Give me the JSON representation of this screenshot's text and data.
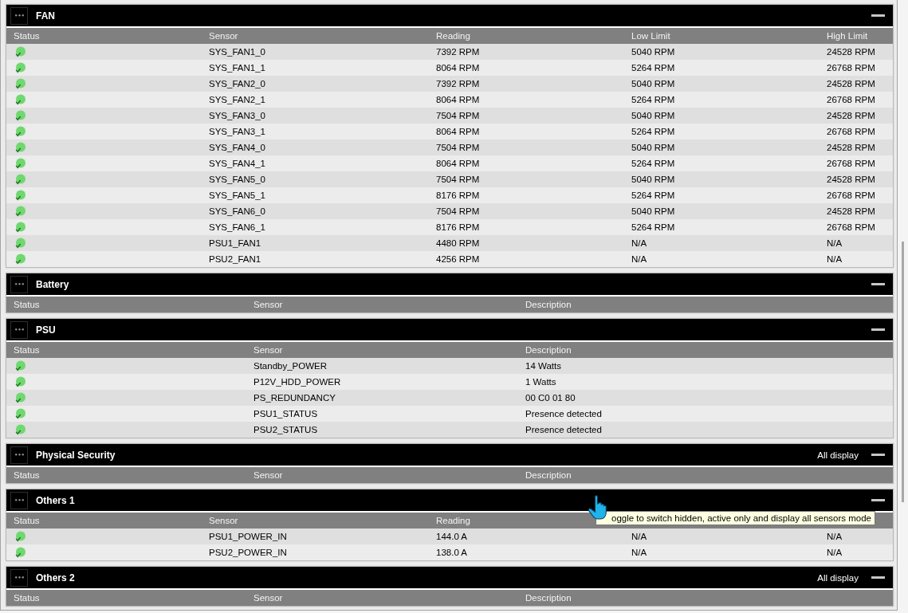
{
  "sections": [
    {
      "title": "FAN",
      "columns": [
        "Status",
        "Sensor",
        "Reading",
        "Low Limit",
        "High Limit"
      ],
      "rows": [
        {
          "ok": true,
          "cells": [
            "",
            "SYS_FAN1_0",
            "7392 RPM",
            "5040 RPM",
            "24528 RPM"
          ]
        },
        {
          "ok": true,
          "cells": [
            "",
            "SYS_FAN1_1",
            "8064 RPM",
            "5264 RPM",
            "26768 RPM"
          ]
        },
        {
          "ok": true,
          "cells": [
            "",
            "SYS_FAN2_0",
            "7392 RPM",
            "5040 RPM",
            "24528 RPM"
          ]
        },
        {
          "ok": true,
          "cells": [
            "",
            "SYS_FAN2_1",
            "8064 RPM",
            "5264 RPM",
            "26768 RPM"
          ]
        },
        {
          "ok": true,
          "cells": [
            "",
            "SYS_FAN3_0",
            "7504 RPM",
            "5040 RPM",
            "24528 RPM"
          ]
        },
        {
          "ok": true,
          "cells": [
            "",
            "SYS_FAN3_1",
            "8064 RPM",
            "5264 RPM",
            "26768 RPM"
          ]
        },
        {
          "ok": true,
          "cells": [
            "",
            "SYS_FAN4_0",
            "7504 RPM",
            "5040 RPM",
            "24528 RPM"
          ]
        },
        {
          "ok": true,
          "cells": [
            "",
            "SYS_FAN4_1",
            "8064 RPM",
            "5264 RPM",
            "26768 RPM"
          ]
        },
        {
          "ok": true,
          "cells": [
            "",
            "SYS_FAN5_0",
            "7504 RPM",
            "5040 RPM",
            "24528 RPM"
          ]
        },
        {
          "ok": true,
          "cells": [
            "",
            "SYS_FAN5_1",
            "8176 RPM",
            "5264 RPM",
            "26768 RPM"
          ]
        },
        {
          "ok": true,
          "cells": [
            "",
            "SYS_FAN6_0",
            "7504 RPM",
            "5040 RPM",
            "24528 RPM"
          ]
        },
        {
          "ok": true,
          "cells": [
            "",
            "SYS_FAN6_1",
            "8176 RPM",
            "5264 RPM",
            "26768 RPM"
          ]
        },
        {
          "ok": true,
          "cells": [
            "",
            "PSU1_FAN1",
            "4480 RPM",
            "N/A",
            "N/A"
          ]
        },
        {
          "ok": true,
          "cells": [
            "",
            "PSU2_FAN1",
            "4256 RPM",
            "N/A",
            "N/A"
          ]
        }
      ]
    },
    {
      "title": "Battery",
      "columns": [
        "Status",
        "Sensor",
        "Description"
      ]
    },
    {
      "title": "PSU",
      "columns": [
        "Status",
        "Sensor",
        "Description"
      ],
      "rows": [
        {
          "ok": true,
          "cells": [
            "",
            "Standby_POWER",
            "14 Watts"
          ]
        },
        {
          "ok": true,
          "cells": [
            "",
            "P12V_HDD_POWER",
            "1 Watts"
          ]
        },
        {
          "ok": true,
          "cells": [
            "",
            "PS_REDUNDANCY",
            "00 C0 01 80"
          ]
        },
        {
          "ok": true,
          "cells": [
            "",
            "PSU1_STATUS",
            "Presence detected"
          ]
        },
        {
          "ok": true,
          "cells": [
            "",
            "PSU2_STATUS",
            "Presence detected"
          ]
        }
      ]
    },
    {
      "title": "Physical Security",
      "mode_label": "All display",
      "columns": [
        "Status",
        "Sensor",
        "Description"
      ]
    },
    {
      "title": "Others 1",
      "columns": [
        "Status",
        "Sensor",
        "Reading"
      ],
      "rows": [
        {
          "ok": true,
          "cells": [
            "",
            "PSU1_POWER_IN",
            "144.0 A",
            "N/A",
            "N/A"
          ]
        },
        {
          "ok": true,
          "cells": [
            "",
            "PSU2_POWER_IN",
            "138.0 A",
            "N/A",
            "N/A"
          ]
        }
      ],
      "tooltip": {
        "text": "oggle to switch hidden, active only and display all sensors mode"
      }
    },
    {
      "title": "Others 2",
      "mode_label": "All display",
      "columns": [
        "Status",
        "Sensor",
        "Description"
      ]
    }
  ]
}
